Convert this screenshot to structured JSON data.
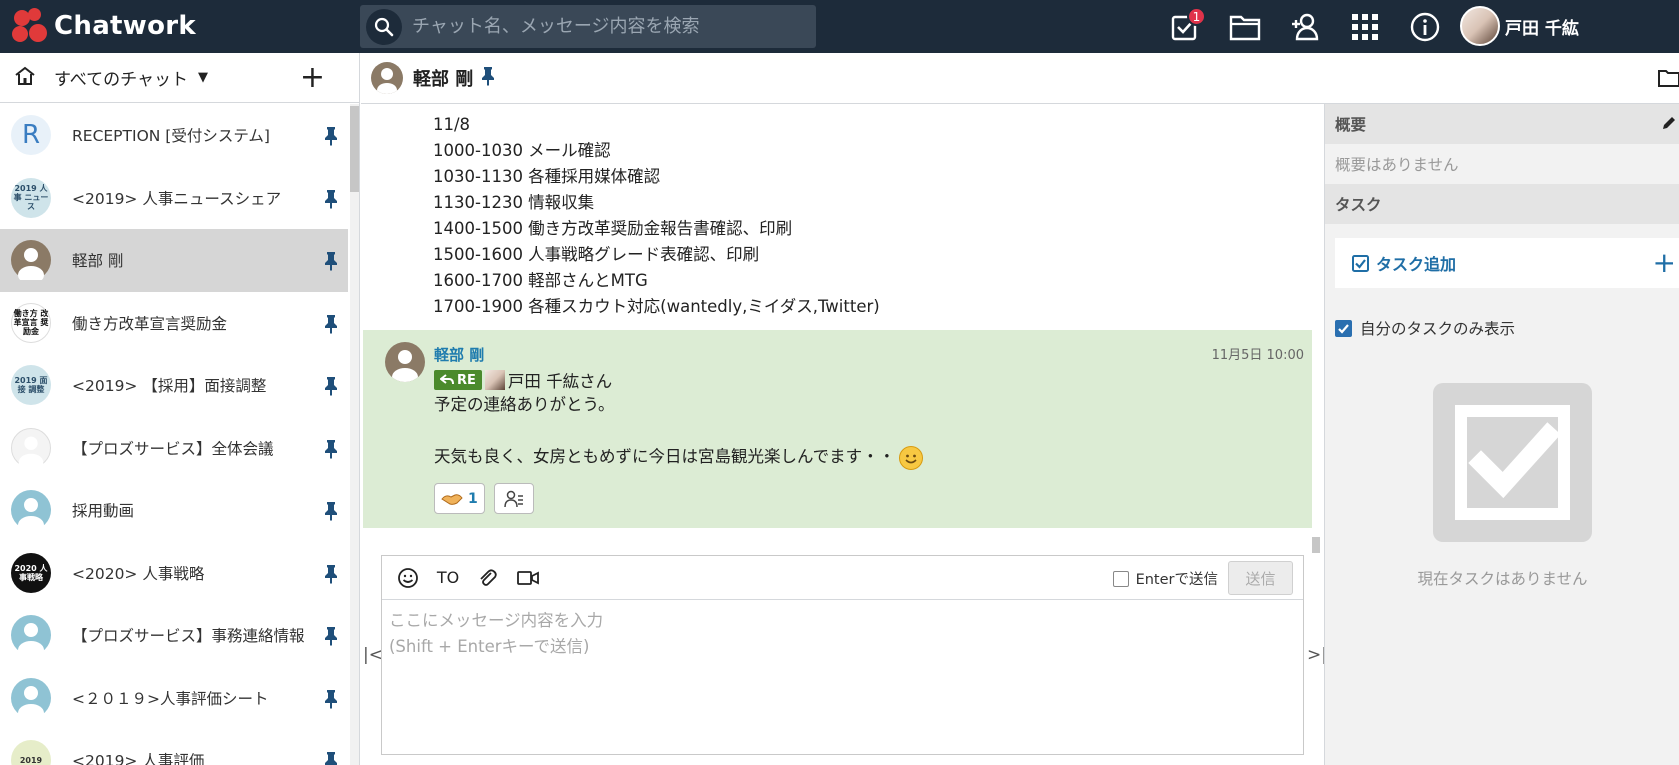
{
  "app": {
    "logo_text": "Chatwork",
    "brand_color": "#e03a3a",
    "header_bg": "#1d2b3a"
  },
  "header": {
    "search_placeholder": "チャット名、メッセージ内容を検索",
    "task_badge": "1",
    "icons": [
      "task-icon",
      "files-icon",
      "add-contact-icon",
      "apps-grid-icon",
      "info-icon"
    ],
    "user_name": "戸田 千紘"
  },
  "sidebar": {
    "filter_label": "すべてのチャット",
    "rooms": [
      {
        "name": "RECEPTION [受付システム]",
        "avatar_text": "R",
        "avatar_bg": "#e8f1f9",
        "avatar_fg": "#3a7dc1"
      },
      {
        "name": "<2019> 人事ニュースシェア",
        "avatar_text": "2019 人事 ニュース",
        "avatar_bg": "#cfe4ea",
        "avatar_fg": "#2c4f6a"
      },
      {
        "name": "軽部 剛",
        "avatar_text": "",
        "avatar_bg": "#8b7a66",
        "avatar_fg": "#fff"
      },
      {
        "name": "働き方改革宣言奨励金",
        "avatar_text": "働き方 改革宣言 奨励金",
        "avatar_bg": "#ffffff",
        "avatar_fg": "#111"
      },
      {
        "name": "<2019> 【採用】面接調整",
        "avatar_text": "2019 面接 調整",
        "avatar_bg": "#cfe4ea",
        "avatar_fg": "#2c4f6a"
      },
      {
        "name": "【プロズサービス】全体会議",
        "avatar_text": "",
        "avatar_bg": "#f4f4f4",
        "avatar_fg": "#333"
      },
      {
        "name": "採用動画",
        "avatar_text": "",
        "avatar_bg": "#8fc3d4",
        "avatar_fg": "#fff"
      },
      {
        "name": "<2020> 人事戦略",
        "avatar_text": "2020 人事戦略",
        "avatar_bg": "#111111",
        "avatar_fg": "#fff"
      },
      {
        "name": "【プロズサービス】事務連絡情報",
        "avatar_text": "",
        "avatar_bg": "#8fc3d4",
        "avatar_fg": "#fff"
      },
      {
        "name": "<２０１９>人事評価シート",
        "avatar_text": "",
        "avatar_bg": "#8fc3d4",
        "avatar_fg": "#fff"
      },
      {
        "name": "<2019> 人事評価",
        "avatar_text": "2019",
        "avatar_bg": "#e6edc9",
        "avatar_fg": "#333"
      }
    ]
  },
  "chat": {
    "title": "軽部 剛",
    "prev_message_lines": [
      "11/8",
      "1000-1030 メール確認",
      "1030-1130 各種採用媒体確認",
      "1130-1230 情報収集",
      "1400-1500 働き方改革奨励金報告書確認、印刷",
      "1500-1600 人事戦略グレード表確認、印刷",
      "1600-1700 軽部さんとMTG",
      "1700-1900 各種スカウト対応(wantedly,ミイダス,Twitter)"
    ],
    "message": {
      "sender": "軽部 剛",
      "time": "11月5日 10:00",
      "re_label": "RE",
      "re_target": "戸田 千紘さん",
      "body_line1": "予定の連絡ありがとう。",
      "body_line2": "天気も良く、女房ともめずに今日は宮島観光楽しんでます・・",
      "reaction_count": "1",
      "bg_color": "#dcecd4"
    }
  },
  "composer": {
    "to_label": "TO",
    "enter_send_label": "Enterで送信",
    "send_label": "送信",
    "placeholder_line1": "ここにメッセージ内容を入力",
    "placeholder_line2": "(Shift + Enterキーで送信)"
  },
  "right_panel": {
    "summary_title": "概要",
    "summary_empty": "概要はありません",
    "task_title": "タスク",
    "task_add_label": "タスク追加",
    "only_mine_label": "自分のタスクのみ表示",
    "no_task_label": "現在タスクはありません"
  }
}
